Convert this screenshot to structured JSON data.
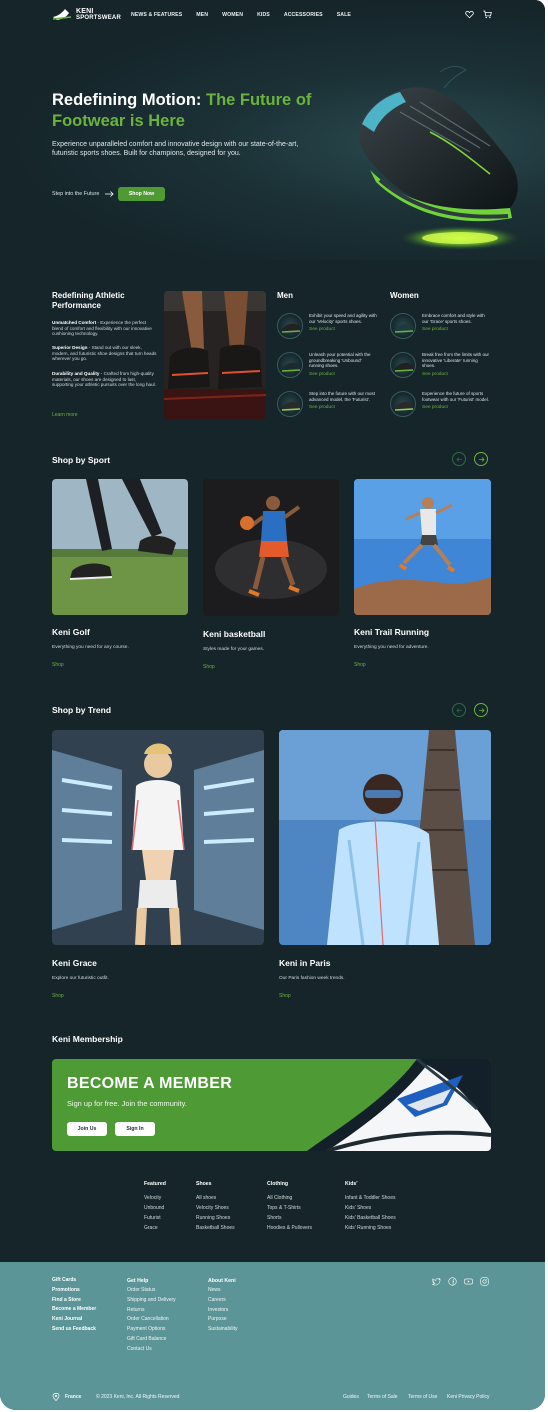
{
  "header": {
    "logo_line1": "KENI",
    "logo_line2": "SPORTSWEAR",
    "nav": [
      "NEWS & FEATURES",
      "MEN",
      "WOMEN",
      "KIDS",
      "ACCESSORIES",
      "SALE"
    ]
  },
  "hero": {
    "title_white": "Redefining Motion: ",
    "title_green": "The Future of Footwear is Here",
    "subtitle": "Experience unparalleled comfort and innovative design with our state-of-the-art, futuristic sports shoes. Built for champions, designed for you.",
    "link_label": "Step into the Future",
    "button_label": "Shop Now"
  },
  "performance": {
    "title": "Redefining Athletic Performance",
    "points": [
      {
        "bold": "Unmatched Comfort",
        "text": " - Experience the perfect blend of comfort and flexibility with our innovative cushioning technology."
      },
      {
        "bold": "Superior Design",
        "text": " - Stand out with our sleek, modern, and futuristic shoe designs that turn heads wherever you go."
      },
      {
        "bold": "Durability and Quality",
        "text": " - Crafted from high-quality materials, our shoes are designed to last, supporting your athletic pursuits over the long haul."
      }
    ],
    "learn_more": "Learn more"
  },
  "men": {
    "title": "Men",
    "products": [
      {
        "text": "Exhibit your speed and agility with our 'Velocity' sports shoes.",
        "link": "See product"
      },
      {
        "text": "Unleash your potential with the groundbreaking 'Unbound' running shoes.",
        "link": "See product"
      },
      {
        "text": "Step into the future with our most advanced model, the 'Futurist'.",
        "link": "See product"
      }
    ]
  },
  "women": {
    "title": "Women",
    "products": [
      {
        "text": "Embrace comfort and style with our 'Grace' sports shoes.",
        "link": "See product"
      },
      {
        "text": "Break free from the limits with our innovative 'Liberate' running shoes.",
        "link": "See product"
      },
      {
        "text": "Experience the future of sports footwear with our 'Futurist' model.",
        "link": "See product"
      }
    ]
  },
  "sport": {
    "title": "Shop by Sport",
    "cards": [
      {
        "title": "Keni Golf",
        "desc": "Everything you need for any course.",
        "link": "Shop"
      },
      {
        "title": "Keni basketball",
        "desc": "Styles made for your games.",
        "link": "Shop"
      },
      {
        "title": "Keni Trail Running",
        "desc": "Everything you need for adventure.",
        "link": "Shop"
      }
    ]
  },
  "trend": {
    "title": "Shop by Trend",
    "cards": [
      {
        "title": "Keni Grace",
        "desc": "Explore our futuristic outfit.",
        "link": "Shop"
      },
      {
        "title": "Keni in Paris",
        "desc": "Our Paris fashion week trends.",
        "link": "Shop"
      }
    ]
  },
  "membership": {
    "section_title": "Keni Membership",
    "heading": "BECOME A MEMBER",
    "subtitle": "Sign up for free. Join the community.",
    "join_label": "Join Us",
    "signin_label": "Sign In"
  },
  "links": [
    {
      "title": "Featured",
      "items": [
        "Velocity",
        "Unbound",
        "Futurist",
        "Grace"
      ]
    },
    {
      "title": "Shoes",
      "items": [
        "All shoes",
        "Velocity Shoes",
        "Running Shoes",
        "Basketball Shoes"
      ]
    },
    {
      "title": "Clothing",
      "items": [
        "All Clothing",
        "Tops & T-Shirts",
        "Shorts",
        "Hoodies & Pullovers"
      ]
    },
    {
      "title": "Kids'",
      "items": [
        "Infant & Toddler Shoes",
        "Kids' Shoes",
        "Kids' Basketball Shoes",
        "Kids' Running Shoes"
      ]
    }
  ],
  "footer": {
    "col1": [
      "Gift Cards",
      "Promotions",
      "Find a Store",
      "Become a Member",
      "Keni Journal",
      "Send us Feedback"
    ],
    "help_title": "Get Help",
    "help": [
      "Order Status",
      "Shipping and Delivery",
      "Returns",
      "Order Cancellation",
      "Payment Options",
      "Gift Card Balance",
      "Contact Us"
    ],
    "about_title": "About Keni",
    "about": [
      "News",
      "Careers",
      "Investors",
      "Purpose",
      "Sustainability"
    ],
    "social_icons": [
      "twitter-icon",
      "facebook-icon",
      "youtube-icon",
      "instagram-icon"
    ],
    "location": "France",
    "copyright": "© 2023 Keni, Inc. All Rights Reserved",
    "legal": [
      "Guides",
      "Terms of Sale",
      "Terms of Use",
      "Keni Privacy Policy"
    ]
  },
  "colors": {
    "background": "#16252a",
    "accent": "#6cb33e",
    "button": "#4f9a34",
    "footer": "#5c9598"
  }
}
